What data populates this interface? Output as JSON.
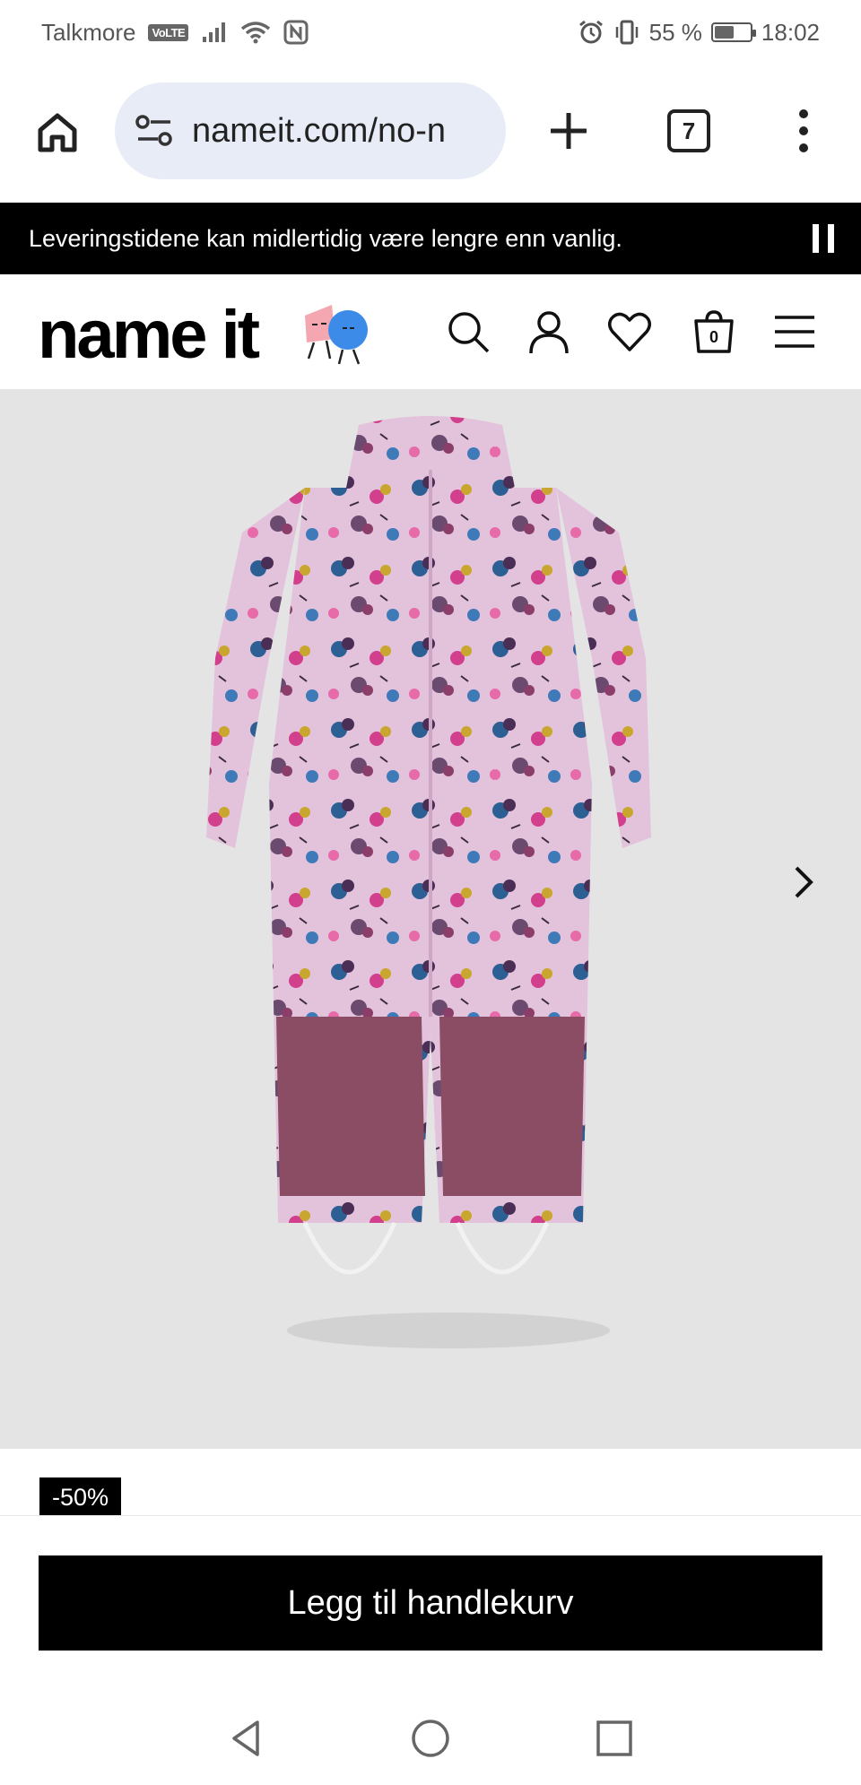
{
  "status_bar": {
    "carrier": "Talkmore",
    "volte": "VoLTE",
    "battery_percent": "55 %",
    "battery_level": 0.55,
    "time": "18:02"
  },
  "browser": {
    "url": "nameit.com/no-n",
    "tab_count": "7"
  },
  "announcement": {
    "text": "Leveringstidene kan midlertidig være lengre enn vanlig."
  },
  "header": {
    "logo_text": "name it",
    "bag_count": "0",
    "icons": [
      "search-icon",
      "account-icon",
      "wishlist-heart-icon",
      "shopping-bag-icon",
      "hamburger-menu-icon"
    ]
  },
  "product": {
    "discount_badge": "-50%",
    "add_to_cart_label": "Legg til handlekurv",
    "colors": {
      "suit_body": "#e3c2dc",
      "suit_panel": "#8a4d63",
      "image_bg": "#e4e4e4"
    }
  },
  "android_nav": {
    "icons": [
      "back-triangle-icon",
      "home-circle-icon",
      "recents-square-icon"
    ]
  }
}
